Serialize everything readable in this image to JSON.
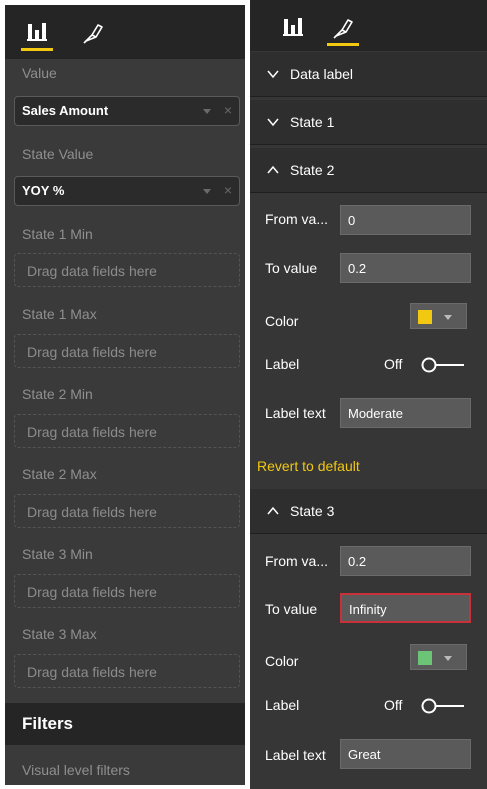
{
  "fields_pane": {
    "wells": [
      {
        "label": "Value",
        "field": "Sales Amount"
      },
      {
        "label": "State Value",
        "field": "YOY %"
      },
      {
        "label": "State 1 Min",
        "placeholder": "Drag data fields here"
      },
      {
        "label": "State 1 Max",
        "placeholder": "Drag data fields here"
      },
      {
        "label": "State 2 Min",
        "placeholder": "Drag data fields here"
      },
      {
        "label": "State 2 Max",
        "placeholder": "Drag data fields here"
      },
      {
        "label": "State 3 Min",
        "placeholder": "Drag data fields here"
      },
      {
        "label": "State 3 Max",
        "placeholder": "Drag data fields here"
      }
    ],
    "remove_glyph": "×",
    "filters": {
      "title": "Filters",
      "subtitle": "Visual level filters"
    }
  },
  "format_pane": {
    "sections": {
      "data_label": "Data label",
      "state1": "State 1",
      "state2": "State 2",
      "state3": "State 3"
    },
    "state2": {
      "from_label": "From va...",
      "from_value": "0",
      "to_label": "To value",
      "to_value": "0.2",
      "color_label": "Color",
      "color": "#f2c811",
      "label_label": "Label",
      "label_toggle": "Off",
      "label_text_label": "Label text",
      "label_text_value": "Moderate"
    },
    "revert": "Revert to default",
    "state3": {
      "from_label": "From va...",
      "from_value": "0.2",
      "to_label": "To value",
      "to_value": "Infinity",
      "color_label": "Color",
      "color": "#6cc476",
      "label_label": "Label",
      "label_toggle": "Off",
      "label_text_label": "Label text",
      "label_text_value": "Great"
    }
  },
  "icons": {
    "fields_tab": "bar-chart-icon",
    "format_tab": "paint-roller-icon"
  },
  "colors": {
    "accent": "#f2c811",
    "error_border": "#c8303c",
    "pane_bg": "#363636",
    "header_bg": "#252525"
  }
}
